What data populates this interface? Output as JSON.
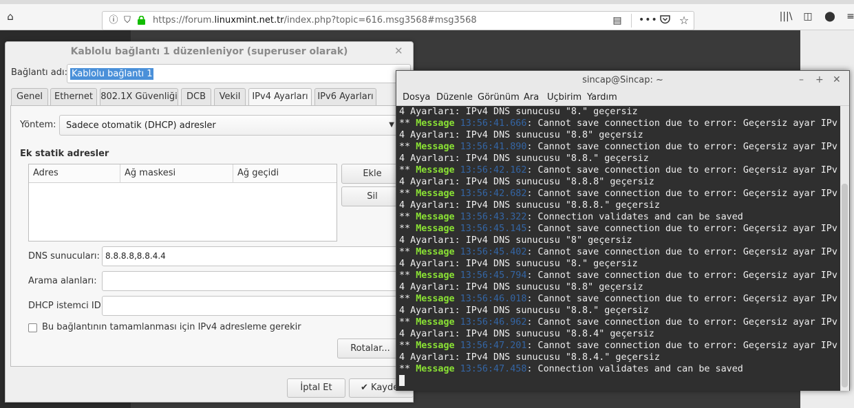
{
  "browser": {
    "url_prefix": "https://forum.",
    "url_domain": "linuxmint.net.tr",
    "url_path": "/index.php?topic=616.msg3568#msg3568"
  },
  "dialog": {
    "title": "Kablolu bağlantı 1 düzenleniyor (superuser olarak)",
    "name_label": "Bağlantı adı:",
    "name_value": "Kablolu bağlantı 1",
    "tabs": [
      "Genel",
      "Ethernet",
      "802.1X Güvenliği",
      "DCB",
      "Vekil",
      "IPv4 Ayarları",
      "IPv6 Ayarları"
    ],
    "active_tab": "IPv4 Ayarları",
    "method_label": "Yöntem:",
    "method_value": "Sadece otomatik (DHCP) adresler",
    "static_heading": "Ek statik adresler",
    "columns": [
      "Adres",
      "Ağ maskesi",
      "Ağ geçidi"
    ],
    "add_button": "Ekle",
    "delete_button": "Sil",
    "dns_label": "DNS sunucuları:",
    "dns_value": "8.8.8.8,8.8.4.4",
    "search_label": "Arama alanları:",
    "search_value": "",
    "dhcp_label": "DHCP istemci ID:",
    "dhcp_value": "",
    "require_ipv4_label": "Bu bağlantının tamamlanması için IPv4 adresleme gerekir",
    "routes_button": "Rotalar...",
    "cancel_button": "İptal Et",
    "save_button": "Kaydet"
  },
  "terminal": {
    "title": "sincap@Sincap: ~",
    "menu": [
      "Dosya",
      "Düzenle",
      "Görünüm",
      "Ara",
      "Uçbirim",
      "Yardım"
    ],
    "lines": [
      {
        "text": "4 Ayarları: IPv4 DNS sunucusu \"8.\" geçersiz"
      },
      {
        "time": "13:56:41.666",
        "text": ": Cannot save connection due to error: Geçersiz ayar IPv"
      },
      {
        "text": "4 Ayarları: IPv4 DNS sunucusu \"8.8\" geçersiz"
      },
      {
        "time": "13:56:41.890",
        "text": ": Cannot save connection due to error: Geçersiz ayar IPv"
      },
      {
        "text": "4 Ayarları: IPv4 DNS sunucusu \"8.8.\" geçersiz"
      },
      {
        "time": "13:56:42.162",
        "text": ": Cannot save connection due to error: Geçersiz ayar IPv"
      },
      {
        "text": "4 Ayarları: IPv4 DNS sunucusu \"8.8.8\" geçersiz"
      },
      {
        "time": "13:56:42.682",
        "text": ": Cannot save connection due to error: Geçersiz ayar IPv"
      },
      {
        "text": "4 Ayarları: IPv4 DNS sunucusu \"8.8.8.\" geçersiz"
      },
      {
        "time": "13:56:43.322",
        "text": ": Connection validates and can be saved"
      },
      {
        "time": "13:56:45.145",
        "text": ": Cannot save connection due to error: Geçersiz ayar IPv"
      },
      {
        "text": "4 Ayarları: IPv4 DNS sunucusu \"8\" geçersiz"
      },
      {
        "time": "13:56:45.402",
        "text": ": Cannot save connection due to error: Geçersiz ayar IPv"
      },
      {
        "text": "4 Ayarları: IPv4 DNS sunucusu \"8.\" geçersiz"
      },
      {
        "time": "13:56:45.794",
        "text": ": Cannot save connection due to error: Geçersiz ayar IPv"
      },
      {
        "text": "4 Ayarları: IPv4 DNS sunucusu \"8.8\" geçersiz"
      },
      {
        "time": "13:56:46.018",
        "text": ": Cannot save connection due to error: Geçersiz ayar IPv"
      },
      {
        "text": "4 Ayarları: IPv4 DNS sunucusu \"8.8.\" geçersiz"
      },
      {
        "time": "13:56:46.962",
        "text": ": Cannot save connection due to error: Geçersiz ayar IPv"
      },
      {
        "text": "4 Ayarları: IPv4 DNS sunucusu \"8.8.4\" geçersiz"
      },
      {
        "time": "13:56:47.201",
        "text": ": Cannot save connection due to error: Geçersiz ayar IPv"
      },
      {
        "text": "4 Ayarları: IPv4 DNS sunucusu \"8.8.4.\" geçersiz"
      },
      {
        "time": "13:56:47.458",
        "text": ": Connection validates and can be saved"
      }
    ],
    "prefix": "** ",
    "message_word": "Message"
  }
}
